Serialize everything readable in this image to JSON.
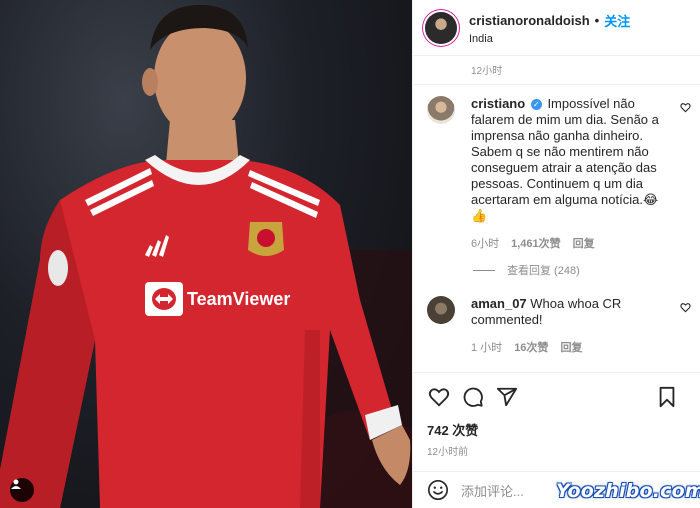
{
  "post": {
    "username": "cristianoronaldoish",
    "separator": "•",
    "follow_label": "关注",
    "location": "India",
    "time_top": "12小时"
  },
  "comments": [
    {
      "username": "cristiano",
      "verified": true,
      "text": "Impossível não falarem de mim um dia. Senão a imprensa não ganha dinheiro. Sabem q se não mentirem não conseguem atrair a atenção das pessoas. Continuem q um dia acertaram em alguma notícia.😂👍",
      "time": "6小时",
      "likes": "1,461次赞",
      "reply_label": "回复",
      "view_replies": "查看回复 (248)"
    },
    {
      "username": "aman_07",
      "verified": false,
      "text": "Whoa whoa CR commented!",
      "time": "1 小时",
      "likes": "16次赞",
      "reply_label": "回复"
    }
  ],
  "footer": {
    "likes": "742 次赞",
    "time": "12小时前",
    "comment_placeholder": "添加评论..."
  },
  "photo": {
    "jersey_sponsor": "TeamViewer"
  },
  "watermark": "Yoozhibo.com",
  "colors": {
    "follow_blue": "#0095f6",
    "verified_blue": "#3897f0",
    "jersey_red": "#d3262f",
    "muted_text": "#8e8e8e"
  },
  "icons": [
    "tag-user-icon",
    "verified-icon",
    "heart-icon",
    "comment-icon",
    "share-icon",
    "bookmark-icon",
    "emoji-icon"
  ]
}
